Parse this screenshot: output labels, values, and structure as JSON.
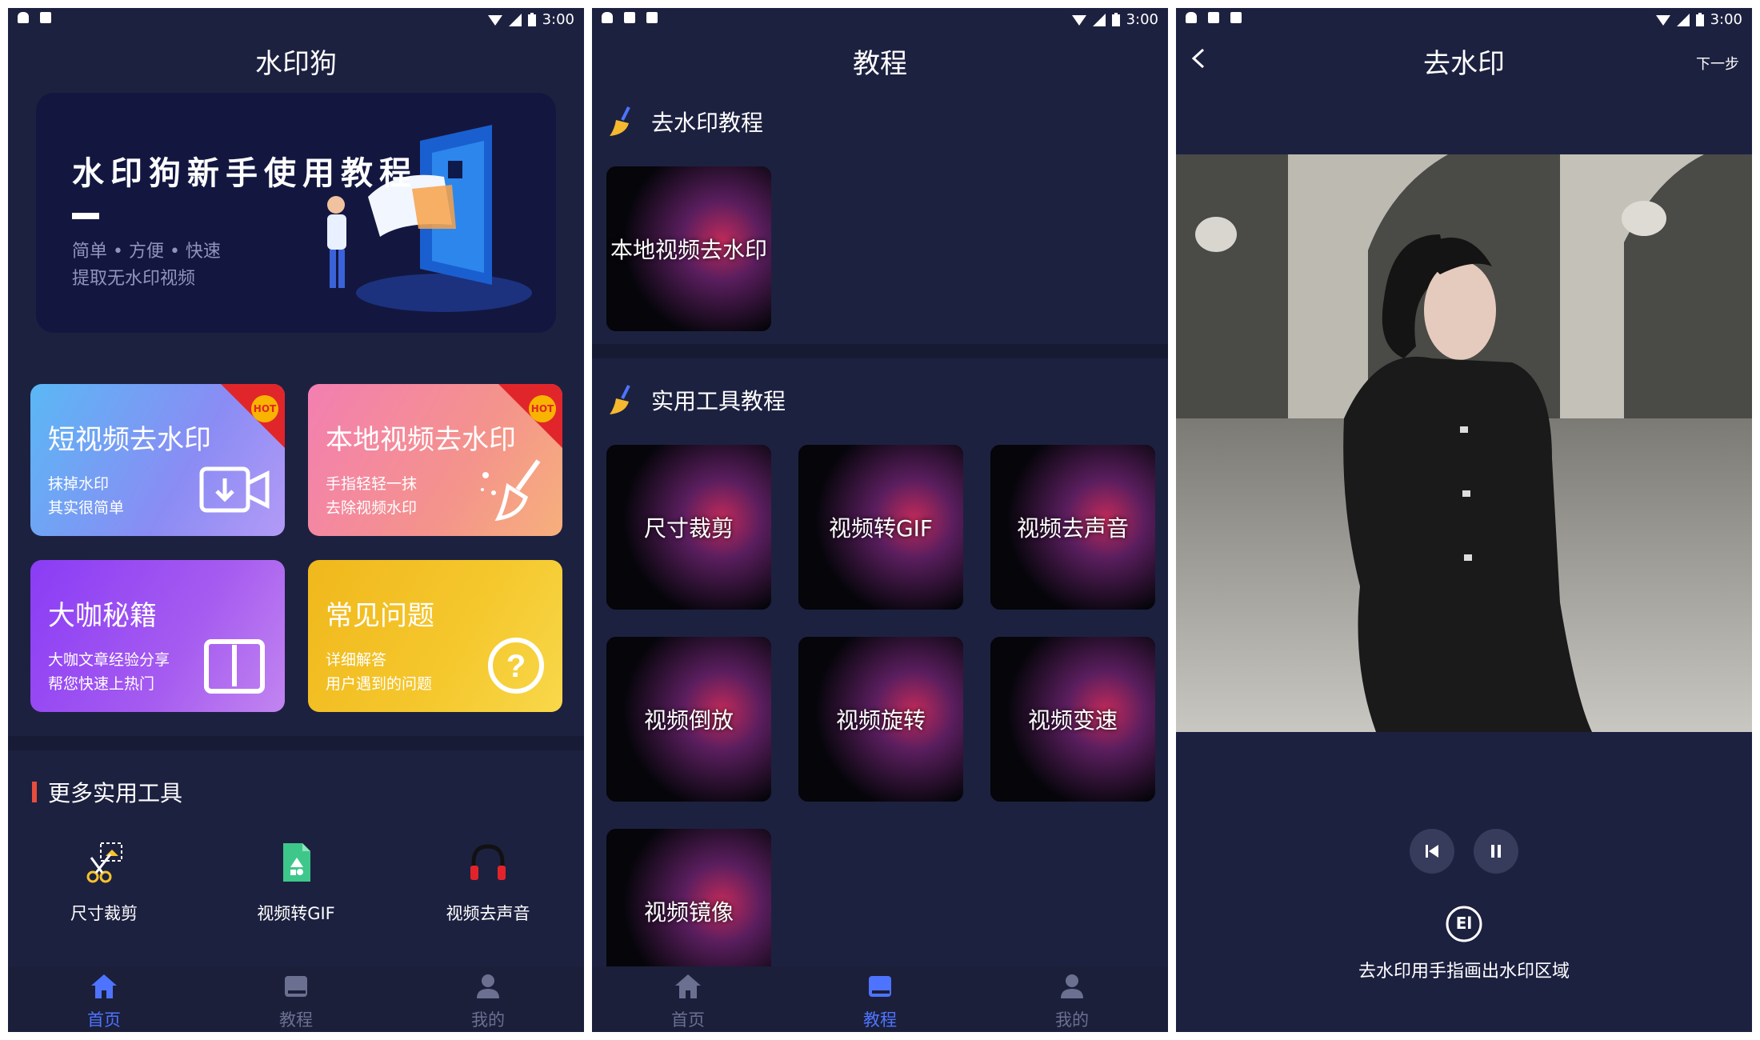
{
  "status": {
    "time": "3:00"
  },
  "home": {
    "title": "水印狗",
    "banner": {
      "title": "水印狗新手使用教程",
      "subtitle1": "简单 • 方便 • 快速",
      "subtitle2": "提取无水印视频"
    },
    "cards": [
      {
        "title": "短视频去水印",
        "line1": "抹掉水印",
        "line2": "其实很简单",
        "badge": "HOT"
      },
      {
        "title": "本地视频去水印",
        "line1": "手指轻轻一抹",
        "line2": "去除视频水印",
        "badge": "HOT"
      },
      {
        "title": "大咖秘籍",
        "line1": "大咖文章经验分享",
        "line2": "帮您快速上热门"
      },
      {
        "title": "常见问题",
        "line1": "详细解答",
        "line2": "用户遇到的问题"
      }
    ],
    "more_tools_title": "更多实用工具",
    "tools": [
      {
        "label": "尺寸裁剪",
        "icon": "scissors-icon"
      },
      {
        "label": "视频转GIF",
        "icon": "gif-file-icon"
      },
      {
        "label": "视频去声音",
        "icon": "headphones-icon"
      }
    ]
  },
  "nav": {
    "home": "首页",
    "tutorial": "教程",
    "mine": "我的"
  },
  "tutorial": {
    "title": "教程",
    "section1": "去水印教程",
    "section1_items": [
      "本地视频去水印"
    ],
    "section2": "实用工具教程",
    "section2_items": [
      "尺寸裁剪",
      "视频转GIF",
      "视频去声音",
      "视频倒放",
      "视频旋转",
      "视频变速",
      "视频镜像"
    ]
  },
  "remove": {
    "title": "去水印",
    "next": "下一步",
    "hint": "去水印用手指画出水印区域",
    "mode_icon_label": "El"
  },
  "colors": {
    "background": "#1d2140",
    "active": "#4e74ff",
    "inactive": "#6b7091",
    "accent_red": "#e84d3c"
  }
}
